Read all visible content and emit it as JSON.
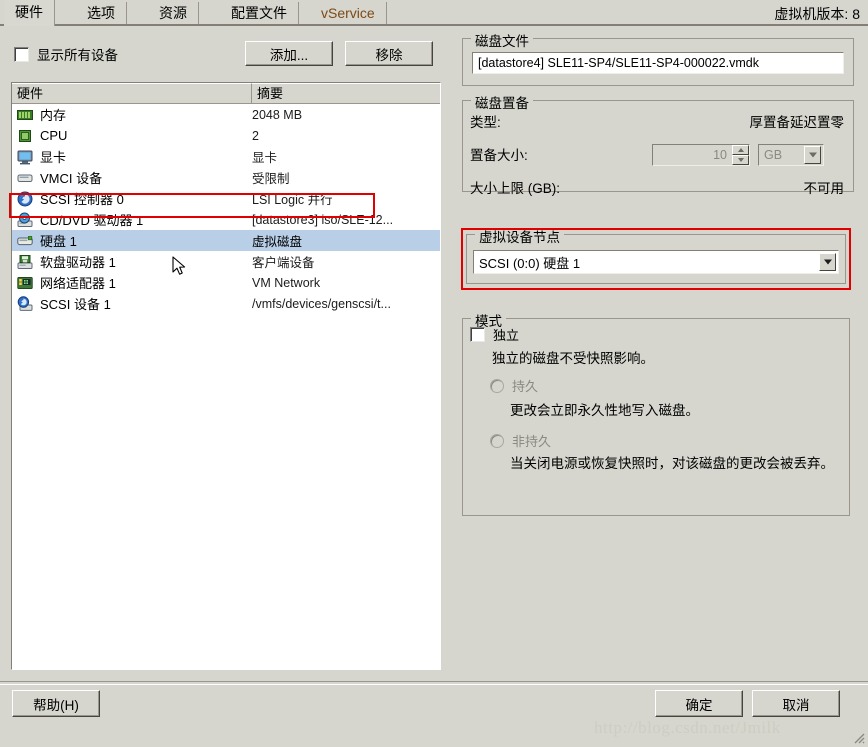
{
  "window": {
    "vm_version_label": "虚拟机版本: 8",
    "watermark": "http://blog.csdn.net/Jmilk"
  },
  "tabs": [
    {
      "label": "硬件",
      "active": true
    },
    {
      "label": "选项",
      "active": false
    },
    {
      "label": "资源",
      "active": false
    },
    {
      "label": "配置文件",
      "active": false
    },
    {
      "label": "vService",
      "active": false
    }
  ],
  "left_pane": {
    "show_all_devices": {
      "label": "显示所有设备",
      "checked": false
    },
    "add_button": "添加...",
    "remove_button": "移除",
    "table": {
      "columns": [
        "硬件",
        "摘要"
      ],
      "rows": [
        {
          "icon": "memory-icon",
          "name": "内存",
          "summary": "2048 MB",
          "selected": false,
          "highlighted": false
        },
        {
          "icon": "cpu-icon",
          "name": "CPU",
          "summary": "2",
          "selected": false,
          "highlighted": false
        },
        {
          "icon": "video-card-icon",
          "name": "显卡",
          "summary": "显卡",
          "selected": false,
          "highlighted": false
        },
        {
          "icon": "vmci-device-icon",
          "name": "VMCI 设备",
          "summary": "受限制",
          "selected": false,
          "highlighted": false
        },
        {
          "icon": "scsi-controller-icon",
          "name": "SCSI 控制器  0",
          "summary": "LSI Logic 并行",
          "selected": false,
          "highlighted": true
        },
        {
          "icon": "cd-dvd-drive-icon",
          "name": "CD/DVD 驱动器  1",
          "summary": "[datastore3] iso/SLE-12...",
          "selected": false,
          "highlighted": false
        },
        {
          "icon": "hard-disk-icon",
          "name": "硬盘  1",
          "summary": "虚拟磁盘",
          "selected": true,
          "highlighted": false
        },
        {
          "icon": "floppy-drive-icon",
          "name": "软盘驱动器  1",
          "summary": "客户端设备",
          "selected": false,
          "highlighted": false
        },
        {
          "icon": "network-adapter-icon",
          "name": "网络适配器  1",
          "summary": "VM Network",
          "selected": false,
          "highlighted": false
        },
        {
          "icon": "scsi-device-icon",
          "name": "SCSI 设备  1",
          "summary": "/vmfs/devices/genscsi/t...",
          "selected": false,
          "highlighted": false
        }
      ]
    }
  },
  "right_pane": {
    "disk_file": {
      "legend": "磁盘文件",
      "value": "[datastore4] SLE11-SP4/SLE11-SP4-000022.vmdk"
    },
    "disk_provisioning": {
      "legend": "磁盘置备",
      "type_label": "类型:",
      "type_value": "厚置备延迟置零",
      "provisioned_size_label": "置备大小:",
      "provisioned_size_value": "10",
      "provisioned_size_unit": "GB",
      "max_size_label": "大小上限 (GB):",
      "max_size_value": "不可用"
    },
    "virtual_device_node": {
      "legend": "虚拟设备节点",
      "selected": "SCSI (0:0) 硬盘 1",
      "highlighted": true
    },
    "mode": {
      "legend": "模式",
      "independent": {
        "label": "独立",
        "checked": false,
        "description": "独立的磁盘不受快照影响。"
      },
      "persistent": {
        "label": "持久",
        "selected": false,
        "disabled": true,
        "description": "更改会立即永久性地写入磁盘。"
      },
      "nonpersistent": {
        "label": "非持久",
        "selected": false,
        "disabled": true,
        "description": "当关闭电源或恢复快照时，对该磁盘的更改会被丢弃。"
      }
    }
  },
  "footer": {
    "help_button": "帮助(H)",
    "ok_button": "确定",
    "cancel_button": "取消"
  },
  "colors": {
    "dialog_background": "#d6d6ce",
    "selection_blue": "#b9cfe8",
    "annotation_red": "#e10000",
    "vservice_tab": "#7c4a16"
  }
}
